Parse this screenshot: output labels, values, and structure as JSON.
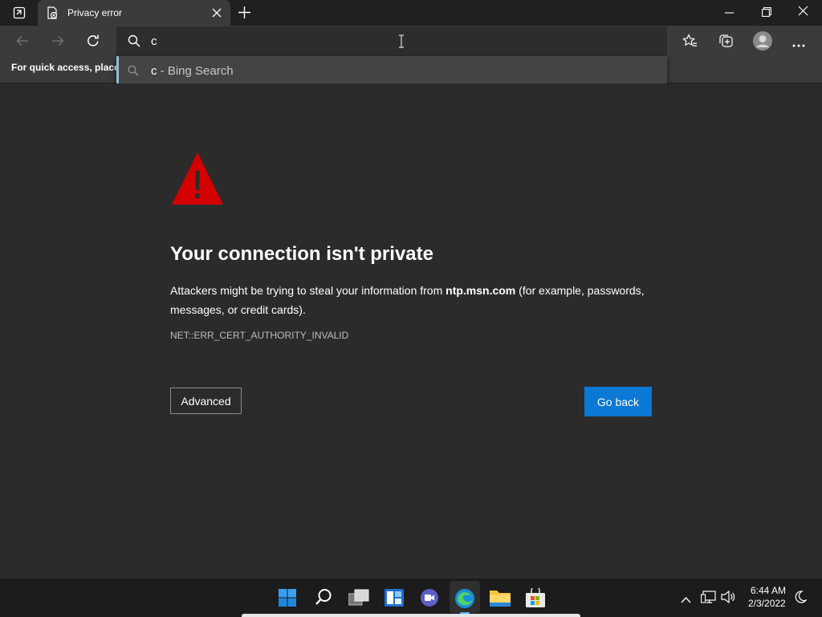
{
  "tab": {
    "title": "Privacy error"
  },
  "address": {
    "value": "c"
  },
  "suggestion": {
    "query": "c",
    "suffix": " - Bing Search"
  },
  "favorites_bar": {
    "text": "For quick access, place y"
  },
  "error": {
    "heading": "Your connection isn't private",
    "body_prefix": "Attackers might be trying to steal your information from ",
    "host": "ntp.msn.com",
    "body_suffix_line1": " (for example, passwords,",
    "body_line2": "messages, or credit cards).",
    "code": "NET::ERR_CERT_AUTHORITY_INVALID"
  },
  "buttons": {
    "advanced": "Advanced",
    "go_back": "Go back"
  },
  "clock": {
    "time": "6:44 AM",
    "date": "2/3/2022"
  },
  "colors": {
    "primary_button": "#0a78d4",
    "warning_icon": "#d30000"
  }
}
